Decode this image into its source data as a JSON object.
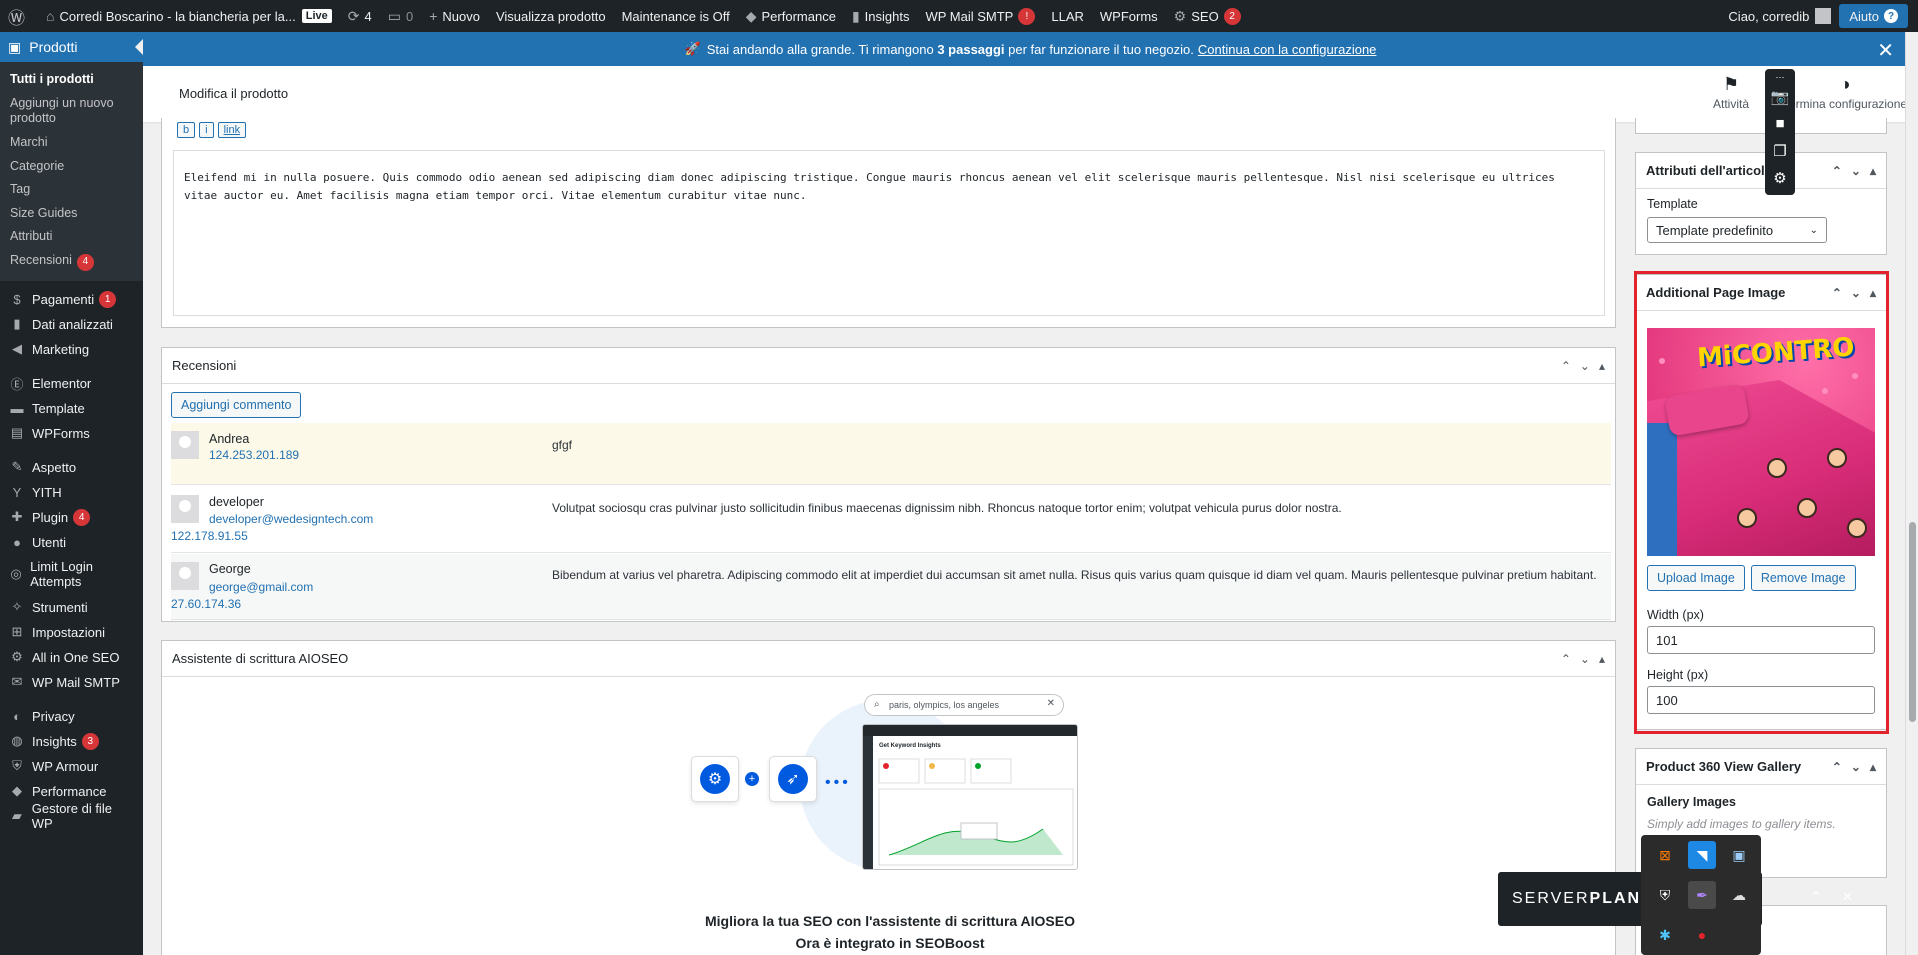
{
  "adminbar": {
    "site_title": "Corredi Boscarino - la biancheria per la...",
    "live": "Live",
    "updates_count": "4",
    "comments_count": "0",
    "new_label": "Nuovo",
    "view_product": "Visualizza prodotto",
    "maintenance": "Maintenance is Off",
    "performance": "Performance",
    "insights": "Insights",
    "wp_mail_smtp": "WP Mail SMTP",
    "wp_mail_smtp_badge": "!",
    "llar": "LLAR",
    "wpforms": "WPForms",
    "seo": "SEO",
    "seo_badge": "2",
    "greeting": "Ciao, corredib",
    "help": "Aiuto"
  },
  "sidebar": {
    "current": "Prodotti",
    "submenu": [
      "Tutti i prodotti",
      "Aggiungi un nuovo prodotto",
      "Marchi",
      "Categorie",
      "Tag",
      "Size Guides",
      "Attributi",
      "Recensioni"
    ],
    "recensioni_badge": "4",
    "items": [
      {
        "label": "Pagamenti",
        "badge": "1"
      },
      {
        "label": "Dati analizzati"
      },
      {
        "label": "Marketing"
      },
      {
        "label": "Elementor"
      },
      {
        "label": "Template"
      },
      {
        "label": "WPForms"
      },
      {
        "label": "Aspetto"
      },
      {
        "label": "YITH"
      },
      {
        "label": "Plugin",
        "badge": "4"
      },
      {
        "label": "Utenti"
      },
      {
        "label": "Limit Login Attempts"
      },
      {
        "label": "Strumenti"
      },
      {
        "label": "Impostazioni"
      },
      {
        "label": "All in One SEO"
      },
      {
        "label": "WP Mail SMTP"
      },
      {
        "label": "Privacy"
      },
      {
        "label": "Insights",
        "badge": "3"
      },
      {
        "label": "WP Armour"
      },
      {
        "label": "Performance"
      },
      {
        "label": "Gestore di file WP"
      }
    ]
  },
  "notice": {
    "text_before": "Stai andando alla grande. Ti rimangono",
    "bold": "3 passaggi",
    "text_after": "per far funzionare il tuo negozio.",
    "link": "Continua con la configurazione"
  },
  "header": {
    "title": "Modifica il prodotto",
    "activity": "Attività",
    "config": "Termina configurazione"
  },
  "editor": {
    "buttons": [
      "b",
      "i",
      "link"
    ],
    "text": "Eleifend mi in nulla posuere. Quis commodo odio aenean sed adipiscing diam donec adipiscing tristique. Congue mauris rhoncus aenean vel elit scelerisque mauris pellentesque. Nisl nisi scelerisque eu ultrices vitae auctor eu. Amet facilisis magna etiam tempor orci. Vitae elementum curabitur vitae nunc."
  },
  "reviews": {
    "title": "Recensioni",
    "add_button": "Aggiungi commento",
    "rows": [
      {
        "name": "Andrea",
        "email": "",
        "ip": "124.253.201.189",
        "text": "gfgf"
      },
      {
        "name": "developer",
        "email": "developer@wedesigntech.com",
        "ip": "122.178.91.55",
        "text": "Volutpat sociosqu cras pulvinar justo sollicitudin finibus maecenas dignissim nibh. Rhoncus natoque tortor enim; volutpat vehicula purus dolor nostra."
      },
      {
        "name": "George",
        "email": "george@gmail.com",
        "ip": "27.60.174.36",
        "text": "Bibendum at varius vel pharetra. Adipiscing commodo elit at imperdiet dui accumsan sit amet nulla. Risus quis varius quam quisque id diam vel quam. Mauris pellentesque pulvinar pretium habitant."
      }
    ]
  },
  "aioseo": {
    "title": "Assistente di scrittura AIOSEO",
    "search_placeholder": "paris, olympics, los angeles",
    "dash_title": "Get Keyword Insights",
    "line1": "Migliora la tua SEO con l'assistente di scrittura AIOSEO",
    "line2": "Ora è integrato in SEOBoost"
  },
  "attributes": {
    "title": "Attributi dell'articolo",
    "template_label": "Template",
    "template_value": "Template predefinito"
  },
  "page_image": {
    "title": "Additional Page Image",
    "logo_text": "MiCONTRO",
    "upload": "Upload Image",
    "remove": "Remove Image",
    "width_label": "Width (px)",
    "width_value": "101",
    "height_label": "Height (px)",
    "height_value": "100"
  },
  "gallery": {
    "title": "Product 360 View Gallery",
    "label": "Gallery Images",
    "hint": "Simply add images to gallery items."
  },
  "tray": {
    "brand_a": "SERVER",
    "brand_b": "PLAN"
  },
  "colors": {
    "accent": "#2271b1",
    "adminbar": "#1d2327",
    "highlight": "#e3232c"
  }
}
